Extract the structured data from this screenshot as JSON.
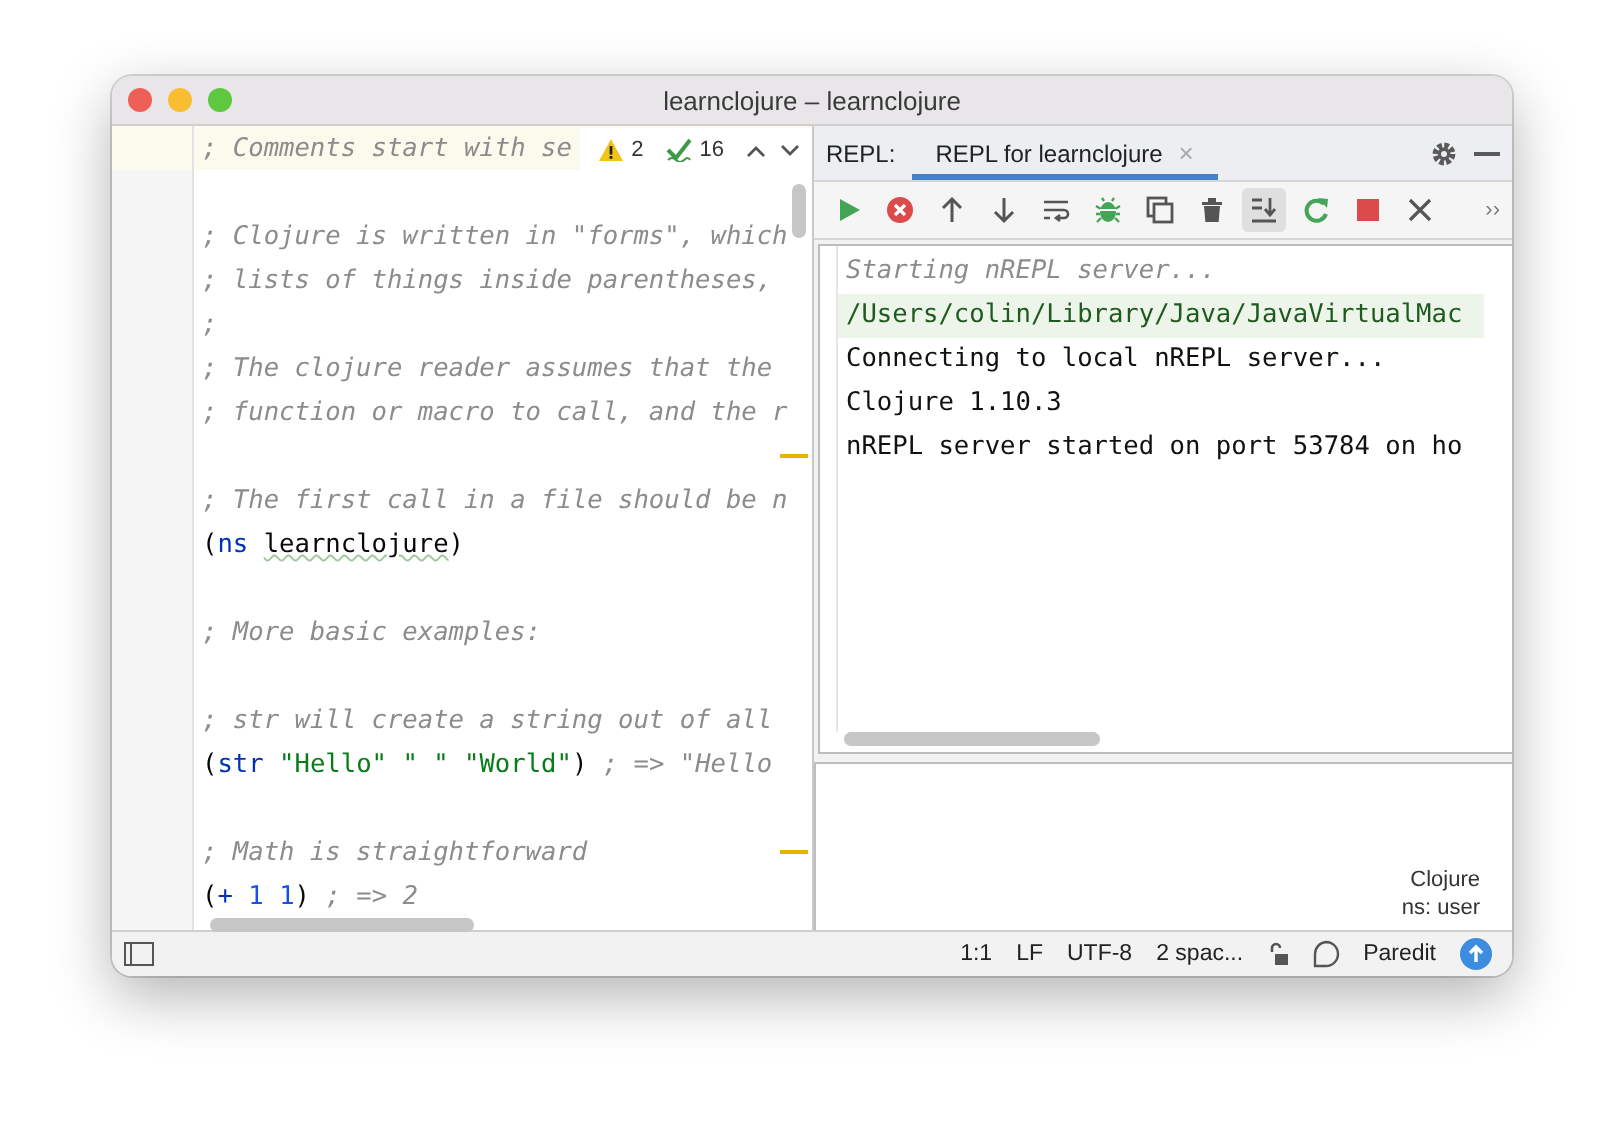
{
  "window": {
    "title": "learnclojure – learnclojure"
  },
  "editor": {
    "inspection": {
      "warnings": "2",
      "checks": "16"
    },
    "lines": [
      {
        "current": true,
        "mark": false,
        "tokens": [
          {
            "kind": "comment",
            "text": "; Comments start with se"
          }
        ]
      },
      {
        "current": false,
        "mark": false
      },
      {
        "current": false,
        "mark": false,
        "tokens": [
          {
            "kind": "comment",
            "text": "; Clojure is written in \"forms\", which"
          }
        ]
      },
      {
        "current": false,
        "mark": false,
        "tokens": [
          {
            "kind": "comment",
            "text": "; lists of things inside parentheses,"
          }
        ]
      },
      {
        "current": false,
        "mark": false,
        "tokens": [
          {
            "kind": "comment",
            "text": ";"
          }
        ]
      },
      {
        "current": false,
        "mark": false,
        "tokens": [
          {
            "kind": "comment",
            "text": "; The clojure reader assumes that the"
          }
        ]
      },
      {
        "current": false,
        "mark": false,
        "tokens": [
          {
            "kind": "comment",
            "text": "; function or macro to call, and the r"
          }
        ]
      },
      {
        "current": false,
        "mark": true
      },
      {
        "current": false,
        "mark": false,
        "tokens": [
          {
            "kind": "comment",
            "text": "; The first call in a file should be n"
          }
        ]
      },
      {
        "current": false,
        "mark": false,
        "tokens": [
          {
            "kind": "paren",
            "text": "("
          },
          {
            "kind": "keyword",
            "text": "ns "
          },
          {
            "kind": "symbol",
            "text": "learnclojure",
            "underlined": true
          },
          {
            "kind": "paren",
            "text": ")"
          }
        ]
      },
      {
        "current": false,
        "mark": false
      },
      {
        "current": false,
        "mark": false,
        "tokens": [
          {
            "kind": "comment",
            "text": "; More basic examples:"
          }
        ]
      },
      {
        "current": false,
        "mark": false
      },
      {
        "current": false,
        "mark": false,
        "tokens": [
          {
            "kind": "comment",
            "text": "; str will create a string out of all"
          }
        ]
      },
      {
        "current": false,
        "mark": false,
        "tokens": [
          {
            "kind": "paren",
            "text": "("
          },
          {
            "kind": "keyword",
            "text": "str "
          },
          {
            "kind": "string",
            "text": "\"Hello\" "
          },
          {
            "kind": "string",
            "text": "\" \" "
          },
          {
            "kind": "string",
            "text": "\"World\""
          },
          {
            "kind": "paren",
            "text": ") "
          },
          {
            "kind": "comment",
            "text": "; => \"Hello"
          }
        ]
      },
      {
        "current": false,
        "mark": false
      },
      {
        "current": false,
        "mark": true,
        "tokens": [
          {
            "kind": "comment",
            "text": "; Math is straightforward"
          }
        ]
      },
      {
        "current": false,
        "mark": false,
        "tokens": [
          {
            "kind": "paren",
            "text": "("
          },
          {
            "kind": "keyword",
            "text": "+ "
          },
          {
            "kind": "number",
            "text": "1 "
          },
          {
            "kind": "number",
            "text": "1"
          },
          {
            "kind": "paren",
            "text": ") "
          },
          {
            "kind": "comment",
            "text": "; => 2"
          }
        ]
      }
    ]
  },
  "repl": {
    "label": "REPL:",
    "tabs": [
      {
        "label": "REPL for learnclojure",
        "selected": true,
        "close": "×"
      }
    ],
    "toolbar": [
      {
        "kind": "run",
        "on": false
      },
      {
        "kind": "stop-circle",
        "on": false
      },
      {
        "kind": "up",
        "on": false
      },
      {
        "kind": "down",
        "on": false
      },
      {
        "kind": "wrap",
        "on": false
      },
      {
        "kind": "bug",
        "on": false
      },
      {
        "kind": "copy",
        "on": false
      },
      {
        "kind": "trash",
        "on": false
      },
      {
        "kind": "scroll-end",
        "on": true
      },
      {
        "kind": "rerun",
        "on": false
      },
      {
        "kind": "stop",
        "on": false
      },
      {
        "kind": "close",
        "on": false
      }
    ],
    "more": "››",
    "output": [
      {
        "kind": "info",
        "text": "Starting nREPL server..."
      },
      {
        "kind": "path",
        "text": "/Users/colin/Library/Java/JavaVirtualMac"
      },
      {
        "kind": "plain",
        "text": "Connecting to local nREPL server..."
      },
      {
        "kind": "plain",
        "text": "Clojure 1.10.3"
      },
      {
        "kind": "plain",
        "text": "nREPL server started on port 53784 on ho"
      }
    ],
    "input": {
      "language": "Clojure",
      "namespace": "ns: user"
    }
  },
  "status_bar": {
    "items": [
      "1:1",
      "LF",
      "UTF-8",
      "2 spac..."
    ],
    "mode": "Paredit"
  }
}
